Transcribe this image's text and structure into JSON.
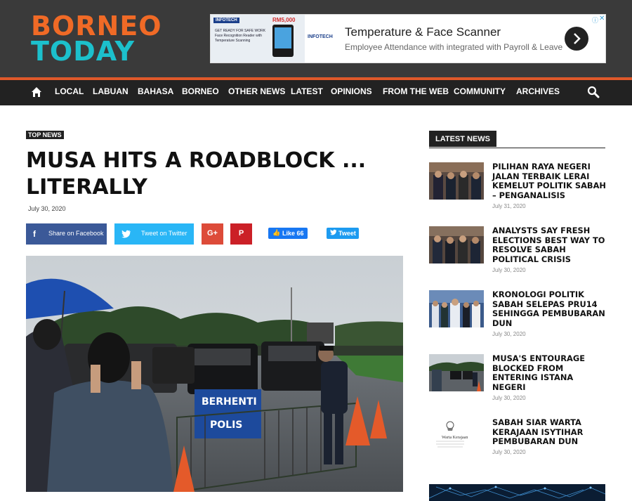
{
  "site": {
    "logo_line1": "BORNEO",
    "logo_line2": "TODAY"
  },
  "ad": {
    "badge": "INFOTECH",
    "price": "RM5,000",
    "small_text": "GET READY FOR SAFE WORK Face Recognition Reader with Temperature Scanning",
    "brand": "INFOTECH",
    "title": "Temperature & Face Scanner",
    "subtitle": "Employee Attendance with integrated with Payroll & Leave"
  },
  "nav": {
    "items": [
      "LOCAL",
      "LABUAN",
      "BAHASA",
      "BORNEO",
      "OTHER NEWS",
      "LATEST",
      "OPINIONS",
      "FROM THE WEB",
      "COMMUNITY",
      "ARCHIVES"
    ]
  },
  "article": {
    "tag": "TOP NEWS",
    "title_line1": "MUSA HITS A ROADBLOCK ...",
    "title_line2": "LITERALLY",
    "date": "July 30, 2020"
  },
  "share": {
    "facebook": "Share on Facebook",
    "twitter": "Tweet on Twitter",
    "like": "Like 66",
    "tweet": "Tweet"
  },
  "sidebar": {
    "heading": "LATEST NEWS",
    "items": [
      {
        "title": "PILIHAN RAYA NEGERI JALAN TERBAIK LERAI KEMELUT POLITIK SABAH – PENGANALISIS",
        "date": "July 31, 2020"
      },
      {
        "title": "ANALYSTS SAY FRESH ELECTIONS BEST WAY TO RESOLVE SABAH POLITICAL CRISIS",
        "date": "July 30, 2020"
      },
      {
        "title": "KRONOLOGI POLITIK SABAH SELEPAS PRU14 SEHINGGA PEMBUBARAN DUN",
        "date": "July 30, 2020"
      },
      {
        "title": "MUSA'S ENTOURAGE BLOCKED FROM ENTERING ISTANA NEGERI",
        "date": "July 30, 2020"
      },
      {
        "title": "SABAH SIAR WARTA KERAJAAN ISYTIHAR PEMBUBARAN DUN",
        "date": "July 30, 2020"
      }
    ]
  },
  "photo": {
    "sign_line1": "BERHENTI",
    "sign_line2": "POLIS"
  },
  "thumb": {
    "warta": "Warta Kerajaan"
  },
  "colors": {
    "header_bg": "#3a3a3a",
    "logo_orange": "#f06a26",
    "logo_teal": "#1cc0cc",
    "nav_bg": "#222222",
    "accent_line": "#e0592a",
    "facebook": "#3b5998",
    "twitter": "#29b6f6",
    "google_plus": "#dd4b39",
    "pinterest": "#cb2027"
  }
}
